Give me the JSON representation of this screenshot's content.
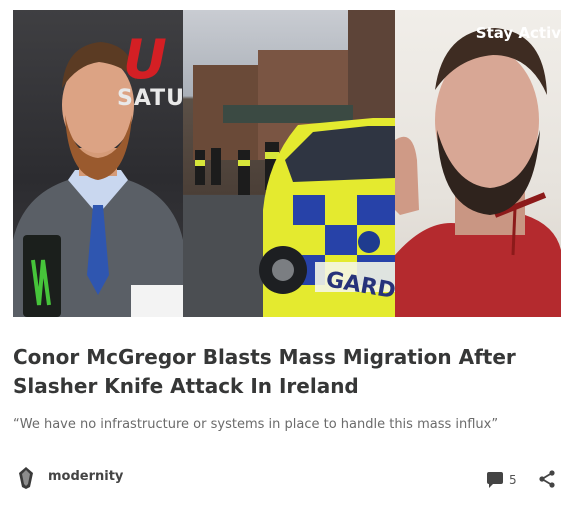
{
  "post": {
    "title": "Conor McGregor Blasts Mass Migration After Slasher Knife Attack In Ireland",
    "subtitle": "“We have no infrastructure or systems in place to handle this mass influx”",
    "author": "modernity",
    "comment_count": "5"
  },
  "image_text": {
    "ufc_letter": "U",
    "ufc_banner": "SATUR",
    "police_car": "GARD",
    "caption": "Stay Activ"
  },
  "icons": {
    "avatar": "avatar-icon",
    "comment": "comment-icon",
    "share": "share-icon"
  },
  "colors": {
    "title": "#363737",
    "subtitle": "#6b6b6b",
    "icon": "#444444"
  }
}
